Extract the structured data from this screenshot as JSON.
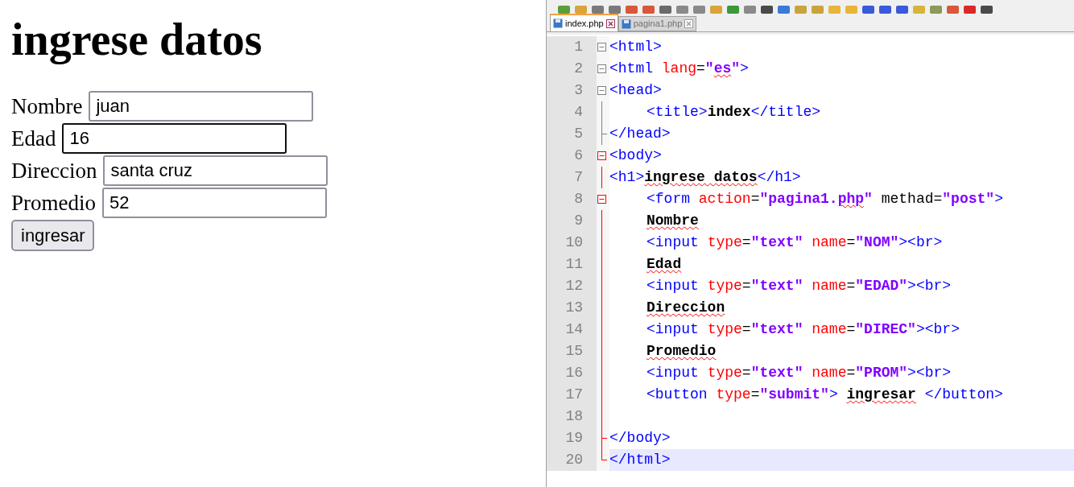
{
  "browser": {
    "heading": "ingrese datos",
    "fields": [
      {
        "label": "Nombre",
        "value": "juan",
        "focused": false
      },
      {
        "label": "Edad",
        "value": "16",
        "focused": true
      },
      {
        "label": "Direccion",
        "value": "santa cruz",
        "focused": false
      },
      {
        "label": "Promedio",
        "value": "52",
        "focused": false
      }
    ],
    "submit": "ingresar"
  },
  "editor": {
    "tabs": [
      {
        "label": "index.php",
        "selected": true
      },
      {
        "label": "pagina1.php",
        "selected": false
      }
    ],
    "lines": [
      {
        "number": "1",
        "kind": "fold_start",
        "in_block": false,
        "indented": false,
        "current": false,
        "tokens": [
          {
            "kind": "tag",
            "text": "<html>"
          }
        ]
      },
      {
        "number": "2",
        "kind": "fold_start",
        "in_block": false,
        "indented": false,
        "current": false,
        "tokens": [
          {
            "kind": "tag",
            "text": "<html "
          },
          {
            "kind": "attr",
            "text": "lang"
          },
          {
            "kind": "plain",
            "text": "="
          },
          {
            "kind": "str",
            "text": "\""
          },
          {
            "kind": "str",
            "text": "es",
            "spell": true
          },
          {
            "kind": "str",
            "text": "\""
          },
          {
            "kind": "tag",
            "text": ">"
          }
        ]
      },
      {
        "number": "3",
        "kind": "fold_start",
        "in_block": false,
        "indented": false,
        "current": false,
        "tokens": [
          {
            "kind": "tag",
            "text": "<head>"
          }
        ]
      },
      {
        "number": "4",
        "kind": "fold_body",
        "in_block": false,
        "indented": true,
        "current": false,
        "tokens": [
          {
            "kind": "tag",
            "text": "<title>"
          },
          {
            "kind": "text",
            "text": "index"
          },
          {
            "kind": "tag",
            "text": "</title>"
          }
        ]
      },
      {
        "number": "5",
        "kind": "fold_end",
        "in_block": false,
        "indented": false,
        "current": false,
        "tokens": [
          {
            "kind": "tag",
            "text": "</head>"
          }
        ]
      },
      {
        "number": "6",
        "kind": "fold_start",
        "in_block": true,
        "indented": false,
        "current": false,
        "tokens": [
          {
            "kind": "tag",
            "text": "<body>"
          }
        ]
      },
      {
        "number": "7",
        "kind": "fold_body",
        "in_block": true,
        "indented": false,
        "current": false,
        "tokens": [
          {
            "kind": "tag",
            "text": "<h1>"
          },
          {
            "kind": "text",
            "text": "ingrese datos",
            "spell": true
          },
          {
            "kind": "tag",
            "text": "</h1>"
          }
        ]
      },
      {
        "number": "8",
        "kind": "fold_start",
        "in_block": true,
        "indented": true,
        "current": false,
        "tokens": [
          {
            "kind": "tag",
            "text": "<form "
          },
          {
            "kind": "attr",
            "text": "action"
          },
          {
            "kind": "plain",
            "text": "="
          },
          {
            "kind": "str",
            "text": "\""
          },
          {
            "kind": "str",
            "text": "pagina1."
          },
          {
            "kind": "str",
            "text": "php",
            "spell": true
          },
          {
            "kind": "str",
            "text": "\""
          },
          {
            "kind": "plain",
            "text": " methad="
          },
          {
            "kind": "str",
            "text": "\"post\""
          },
          {
            "kind": "tag",
            "text": ">"
          }
        ]
      },
      {
        "number": "9",
        "kind": "fold_body",
        "in_block": true,
        "indented": true,
        "current": false,
        "tokens": [
          {
            "kind": "text",
            "text": "Nombre",
            "spell": true
          }
        ]
      },
      {
        "number": "10",
        "kind": "fold_body",
        "in_block": true,
        "indented": true,
        "current": false,
        "tokens": [
          {
            "kind": "tag",
            "text": "<input "
          },
          {
            "kind": "attr",
            "text": "type"
          },
          {
            "kind": "plain",
            "text": "="
          },
          {
            "kind": "str",
            "text": "\"text\""
          },
          {
            "kind": "attr",
            "text": " name"
          },
          {
            "kind": "plain",
            "text": "="
          },
          {
            "kind": "str",
            "text": "\"NOM\""
          },
          {
            "kind": "tag",
            "text": "><br>"
          }
        ]
      },
      {
        "number": "11",
        "kind": "fold_body",
        "in_block": true,
        "indented": true,
        "current": false,
        "tokens": [
          {
            "kind": "text",
            "text": "Edad",
            "spell": true
          }
        ]
      },
      {
        "number": "12",
        "kind": "fold_body",
        "in_block": true,
        "indented": true,
        "current": false,
        "tokens": [
          {
            "kind": "tag",
            "text": "<input "
          },
          {
            "kind": "attr",
            "text": "type"
          },
          {
            "kind": "plain",
            "text": "="
          },
          {
            "kind": "str",
            "text": "\"text\""
          },
          {
            "kind": "attr",
            "text": " name"
          },
          {
            "kind": "plain",
            "text": "="
          },
          {
            "kind": "str",
            "text": "\"EDAD\""
          },
          {
            "kind": "tag",
            "text": "><br>"
          }
        ]
      },
      {
        "number": "13",
        "kind": "fold_body",
        "in_block": true,
        "indented": true,
        "current": false,
        "tokens": [
          {
            "kind": "text",
            "text": "Direccion",
            "spell": true
          }
        ]
      },
      {
        "number": "14",
        "kind": "fold_body",
        "in_block": true,
        "indented": true,
        "current": false,
        "tokens": [
          {
            "kind": "tag",
            "text": "<input "
          },
          {
            "kind": "attr",
            "text": "type"
          },
          {
            "kind": "plain",
            "text": "="
          },
          {
            "kind": "str",
            "text": "\"text\""
          },
          {
            "kind": "attr",
            "text": " name"
          },
          {
            "kind": "plain",
            "text": "="
          },
          {
            "kind": "str",
            "text": "\"DIREC\""
          },
          {
            "kind": "tag",
            "text": "><br>"
          }
        ]
      },
      {
        "number": "15",
        "kind": "fold_body",
        "in_block": true,
        "indented": true,
        "current": false,
        "tokens": [
          {
            "kind": "text",
            "text": "Promedio",
            "spell": true
          }
        ]
      },
      {
        "number": "16",
        "kind": "fold_body",
        "in_block": true,
        "indented": true,
        "current": false,
        "tokens": [
          {
            "kind": "tag",
            "text": "<input "
          },
          {
            "kind": "attr",
            "text": "type"
          },
          {
            "kind": "plain",
            "text": "="
          },
          {
            "kind": "str",
            "text": "\"text\""
          },
          {
            "kind": "attr",
            "text": " name"
          },
          {
            "kind": "plain",
            "text": "="
          },
          {
            "kind": "str",
            "text": "\"PROM\""
          },
          {
            "kind": "tag",
            "text": "><br>"
          }
        ]
      },
      {
        "number": "17",
        "kind": "fold_body",
        "in_block": true,
        "indented": true,
        "current": false,
        "tokens": [
          {
            "kind": "tag",
            "text": "<button "
          },
          {
            "kind": "attr",
            "text": "type"
          },
          {
            "kind": "plain",
            "text": "="
          },
          {
            "kind": "str",
            "text": "\"submit\""
          },
          {
            "kind": "tag",
            "text": "> "
          },
          {
            "kind": "text",
            "text": "ingresar",
            "spell": true
          },
          {
            "kind": "tag",
            "text": " </button>"
          }
        ]
      },
      {
        "number": "18",
        "kind": "fold_body",
        "in_block": true,
        "indented": false,
        "current": false
      },
      {
        "number": "19",
        "kind": "fold_end",
        "in_block": true,
        "indented": false,
        "current": false,
        "tokens": [
          {
            "kind": "tag",
            "text": "</body>"
          }
        ]
      },
      {
        "number": "20",
        "kind": "fold_last",
        "in_block": true,
        "indented": false,
        "current": true,
        "tokens": [
          {
            "kind": "tag",
            "text": "</html>"
          }
        ]
      }
    ]
  }
}
